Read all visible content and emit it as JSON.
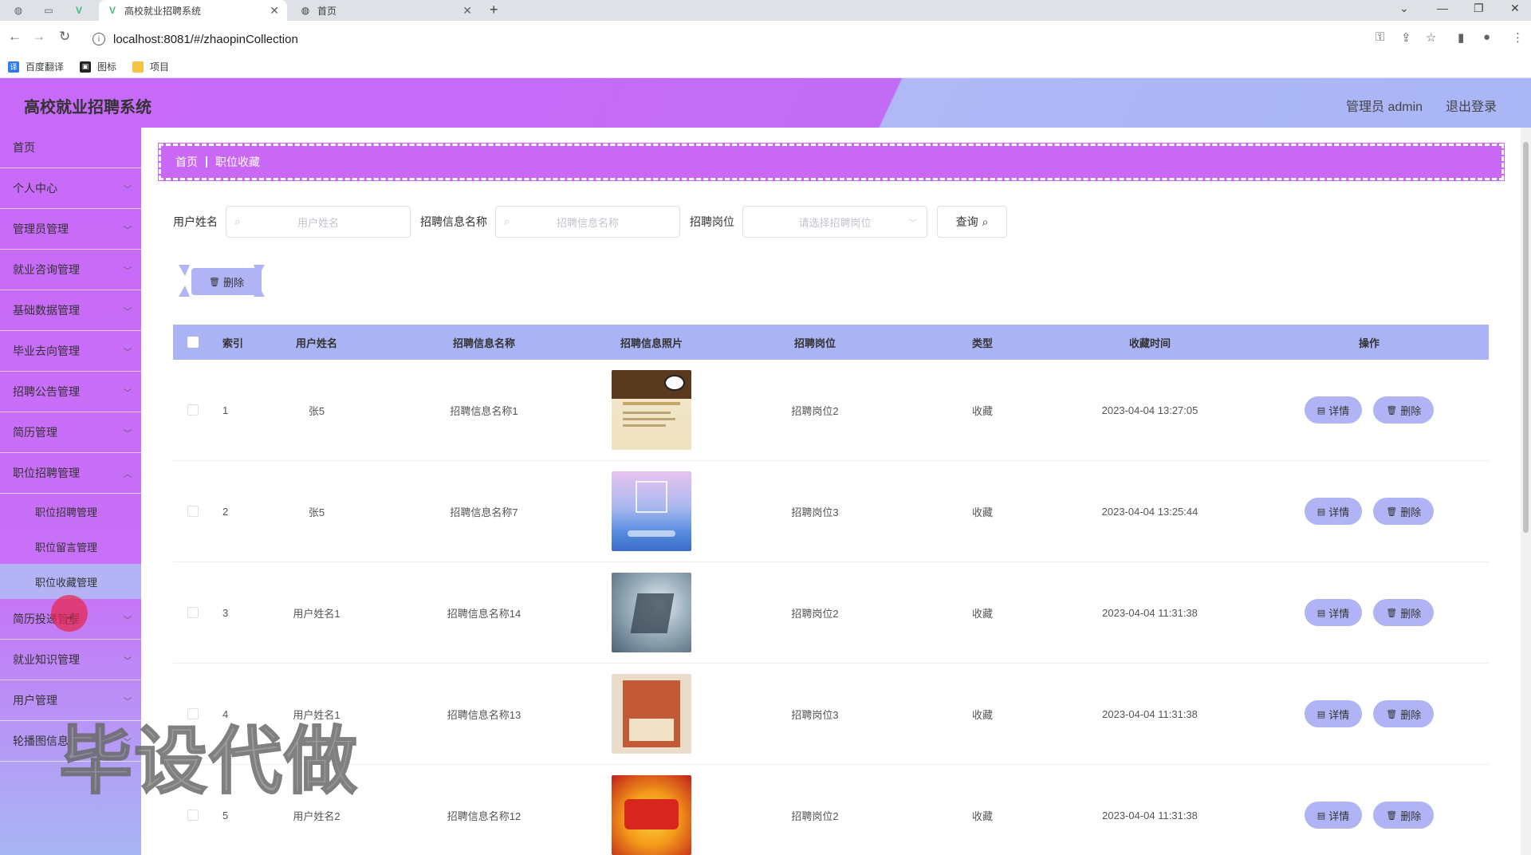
{
  "browser": {
    "tabs": [
      {
        "title": "高校就业招聘系统",
        "active": true
      },
      {
        "title": "首页",
        "active": false
      }
    ],
    "url": "localhost:8081/#/zhaopinCollection",
    "bookmarks": [
      "百度翻译",
      "图标",
      "项目"
    ]
  },
  "header": {
    "title": "高校就业招聘系统",
    "admin_label": "管理员 admin",
    "logout_label": "退出登录"
  },
  "sidebar": {
    "items": [
      {
        "label": "首页",
        "has_children": false
      },
      {
        "label": "个人中心",
        "has_children": true
      },
      {
        "label": "管理员管理",
        "has_children": true
      },
      {
        "label": "就业咨询管理",
        "has_children": true
      },
      {
        "label": "基础数据管理",
        "has_children": true
      },
      {
        "label": "毕业去向管理",
        "has_children": true
      },
      {
        "label": "招聘公告管理",
        "has_children": true
      },
      {
        "label": "简历管理",
        "has_children": true
      },
      {
        "label": "职位招聘管理",
        "has_children": true
      }
    ],
    "subitems": [
      "职位招聘管理",
      "职位留言管理",
      "职位收藏管理"
    ],
    "active_sub": "职位收藏管理",
    "items_after": [
      {
        "label": "简历投递管理",
        "has_children": true
      },
      {
        "label": "就业知识管理",
        "has_children": true
      },
      {
        "label": "用户管理",
        "has_children": true
      },
      {
        "label": "轮播图信息",
        "has_children": true
      }
    ]
  },
  "breadcrumb": {
    "home": "首页",
    "current": "职位收藏"
  },
  "search": {
    "username_label": "用户姓名",
    "username_placeholder": "用户姓名",
    "info_label": "招聘信息名称",
    "info_placeholder": "招聘信息名称",
    "position_label": "招聘岗位",
    "position_placeholder": "请选择招聘岗位",
    "query_label": "查询"
  },
  "bulk_delete_label": "删除",
  "table": {
    "headers": {
      "index": "索引",
      "username": "用户姓名",
      "info_name": "招聘信息名称",
      "photo": "招聘信息照片",
      "position": "招聘岗位",
      "type": "类型",
      "time": "收藏时间",
      "ops": "操作"
    },
    "detail_label": "详情",
    "delete_label": "删除",
    "rows": [
      {
        "index": "1",
        "username": "张5",
        "info_name": "招聘信息名称1",
        "position": "招聘岗位2",
        "type": "收藏",
        "time": "2023-04-04 13:27:05"
      },
      {
        "index": "2",
        "username": "张5",
        "info_name": "招聘信息名称7",
        "position": "招聘岗位3",
        "type": "收藏",
        "time": "2023-04-04 13:25:44"
      },
      {
        "index": "3",
        "username": "用户姓名1",
        "info_name": "招聘信息名称14",
        "position": "招聘岗位2",
        "type": "收藏",
        "time": "2023-04-04 11:31:38"
      },
      {
        "index": "4",
        "username": "用户姓名1",
        "info_name": "招聘信息名称13",
        "position": "招聘岗位3",
        "type": "收藏",
        "time": "2023-04-04 11:31:38"
      },
      {
        "index": "5",
        "username": "用户姓名2",
        "info_name": "招聘信息名称12",
        "position": "招聘岗位2",
        "type": "收藏",
        "time": "2023-04-04 11:31:38"
      }
    ]
  },
  "watermark": "毕设代做",
  "colors": {
    "primary": "#c86af8",
    "accent": "#aab4f4",
    "button": "#b0b4f4"
  }
}
